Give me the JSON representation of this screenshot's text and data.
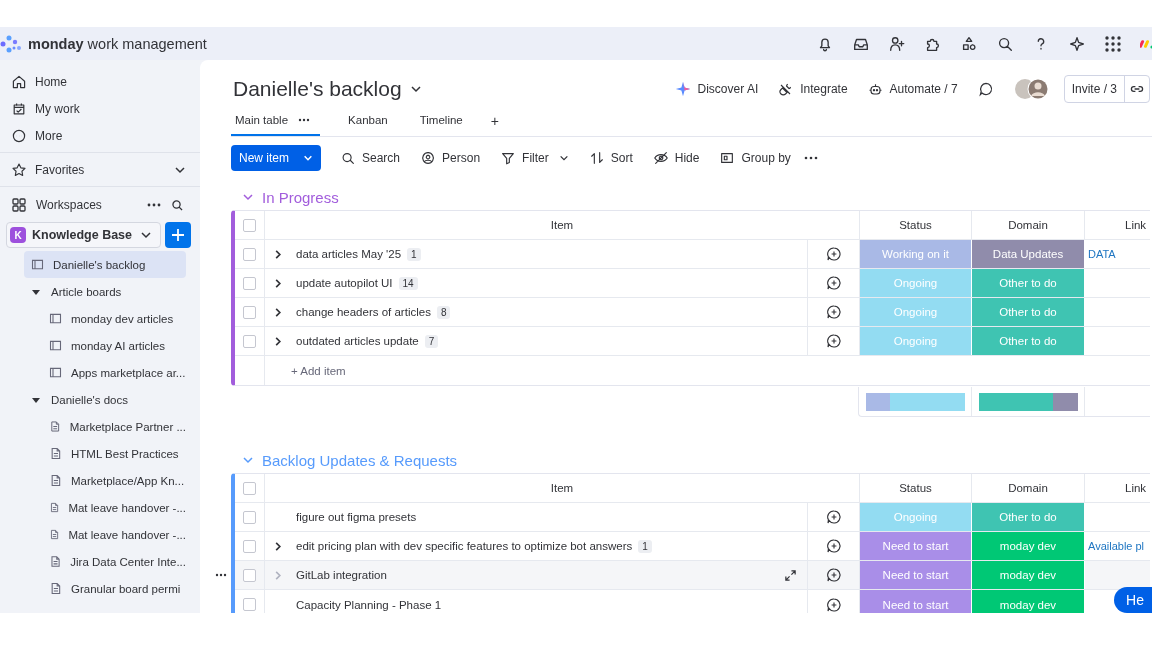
{
  "app": {
    "brand": "monday",
    "product": "work management"
  },
  "sidebar": {
    "nav": [
      {
        "label": "Home"
      },
      {
        "label": "My work"
      },
      {
        "label": "More"
      }
    ],
    "favorites": "Favorites",
    "workspaces_label": "Workspaces",
    "workspace": {
      "badge": "K",
      "name": "Knowledge Base"
    },
    "tree": [
      {
        "kind": "board",
        "label": "Danielle's backlog",
        "selected": true
      },
      {
        "kind": "folder",
        "label": "Article boards",
        "selected": false,
        "expanded": true,
        "children": [
          {
            "kind": "board",
            "label": "monday dev articles",
            "selected": false
          },
          {
            "kind": "board",
            "label": "monday AI articles",
            "selected": false
          },
          {
            "kind": "board",
            "label": "Apps marketplace ar...",
            "selected": false
          }
        ]
      },
      {
        "kind": "folder",
        "label": "Danielle's docs",
        "selected": false,
        "expanded": true,
        "children": [
          {
            "kind": "doc",
            "label": "Marketplace Partner ...",
            "selected": false
          },
          {
            "kind": "doc",
            "label": "HTML Best Practices",
            "selected": false
          },
          {
            "kind": "doc",
            "label": "Marketplace/App Kn...",
            "selected": false
          },
          {
            "kind": "doc",
            "label": "Mat leave handover -...",
            "selected": false
          },
          {
            "kind": "doc",
            "label": "Mat leave handover -...",
            "selected": false
          },
          {
            "kind": "doc",
            "label": "Jira Data Center Inte...",
            "selected": false
          },
          {
            "kind": "doc",
            "label": "Granular board permi",
            "selected": false
          }
        ]
      }
    ]
  },
  "board": {
    "title": "Danielle's backlog",
    "actions": [
      {
        "label": "Discover AI"
      },
      {
        "label": "Integrate"
      },
      {
        "label": "Automate / 7"
      }
    ],
    "invite": "Invite / 3",
    "views": [
      {
        "label": "Main table",
        "selected": true
      },
      {
        "label": "Kanban",
        "selected": false
      },
      {
        "label": "Timeline",
        "selected": false
      }
    ],
    "add_view": "+",
    "new_item": "New item",
    "tools": [
      {
        "label": "Search",
        "dropdown": false
      },
      {
        "label": "Person",
        "dropdown": false
      },
      {
        "label": "Filter",
        "dropdown": true
      },
      {
        "label": "Sort",
        "dropdown": false
      },
      {
        "label": "Hide",
        "dropdown": false
      },
      {
        "label": "Group by",
        "dropdown": false
      }
    ]
  },
  "groups": [
    {
      "title": "In Progress",
      "color": "#a25ddc",
      "all_checked": false,
      "columns": [
        "Item",
        "Status",
        "Domain",
        "Link"
      ],
      "rows": [
        {
          "name": "data articles May '25",
          "subitems": "1",
          "checked": false,
          "expandable": true,
          "hovered": false,
          "status": {
            "label": "Working on it",
            "color": "#a9b9e6"
          },
          "domain": {
            "label": "Data Updates",
            "color": "#908cab"
          },
          "link": "DATA"
        },
        {
          "name": "update autopilot UI",
          "subitems": "14",
          "checked": false,
          "expandable": true,
          "hovered": false,
          "status": {
            "label": "Ongoing",
            "color": "#93dcf2"
          },
          "domain": {
            "label": "Other to do",
            "color": "#3fc4b2"
          }
        },
        {
          "name": "change headers of articles",
          "subitems": "8",
          "checked": false,
          "expandable": true,
          "hovered": false,
          "status": {
            "label": "Ongoing",
            "color": "#93dcf2"
          },
          "domain": {
            "label": "Other to do",
            "color": "#3fc4b2"
          }
        },
        {
          "name": "outdated articles update",
          "subitems": "7",
          "checked": false,
          "expandable": true,
          "hovered": false,
          "status": {
            "label": "Ongoing",
            "color": "#93dcf2"
          },
          "domain": {
            "label": "Other to do",
            "color": "#3fc4b2"
          }
        }
      ],
      "add_item": "+ Add item",
      "summary": {
        "status": [
          {
            "color": "#a9b9e6",
            "level": 0.25
          },
          {
            "color": "#93dcf2",
            "level": 0.75
          }
        ],
        "domain": [
          {
            "color": "#3fc4b2",
            "level": 0.75
          },
          {
            "color": "#908cab",
            "level": 0.25
          }
        ]
      }
    },
    {
      "title": "Backlog Updates & Requests",
      "color": "#579bfc",
      "all_checked": false,
      "columns": [
        "Item",
        "Status",
        "Domain",
        "Link"
      ],
      "rows": [
        {
          "name": "figure out figma presets",
          "checked": false,
          "expandable": false,
          "hovered": false,
          "status": {
            "label": "Ongoing",
            "color": "#93dcf2"
          },
          "domain": {
            "label": "Other to do",
            "color": "#3fc4b2"
          }
        },
        {
          "name": "edit pricing plan with dev specific features to optimize bot answers",
          "subitems": "1",
          "checked": false,
          "expandable": true,
          "hovered": false,
          "status": {
            "label": "Need to start",
            "color": "#a98ee8"
          },
          "domain": {
            "label": "moday dev",
            "color": "#00c875"
          },
          "link": "Available pl"
        },
        {
          "name": "GitLab integration",
          "checked": false,
          "expandable": true,
          "hovered": true,
          "status": {
            "label": "Need to start",
            "color": "#a98ee8"
          },
          "domain": {
            "label": "moday dev",
            "color": "#00c875"
          }
        },
        {
          "name": "Capacity Planning - Phase 1",
          "checked": false,
          "expandable": false,
          "hovered": false,
          "status": {
            "label": "Need to start",
            "color": "#a98ee8"
          },
          "domain": {
            "label": "moday dev",
            "color": "#00c875"
          }
        }
      ]
    }
  ],
  "help_button": "He"
}
